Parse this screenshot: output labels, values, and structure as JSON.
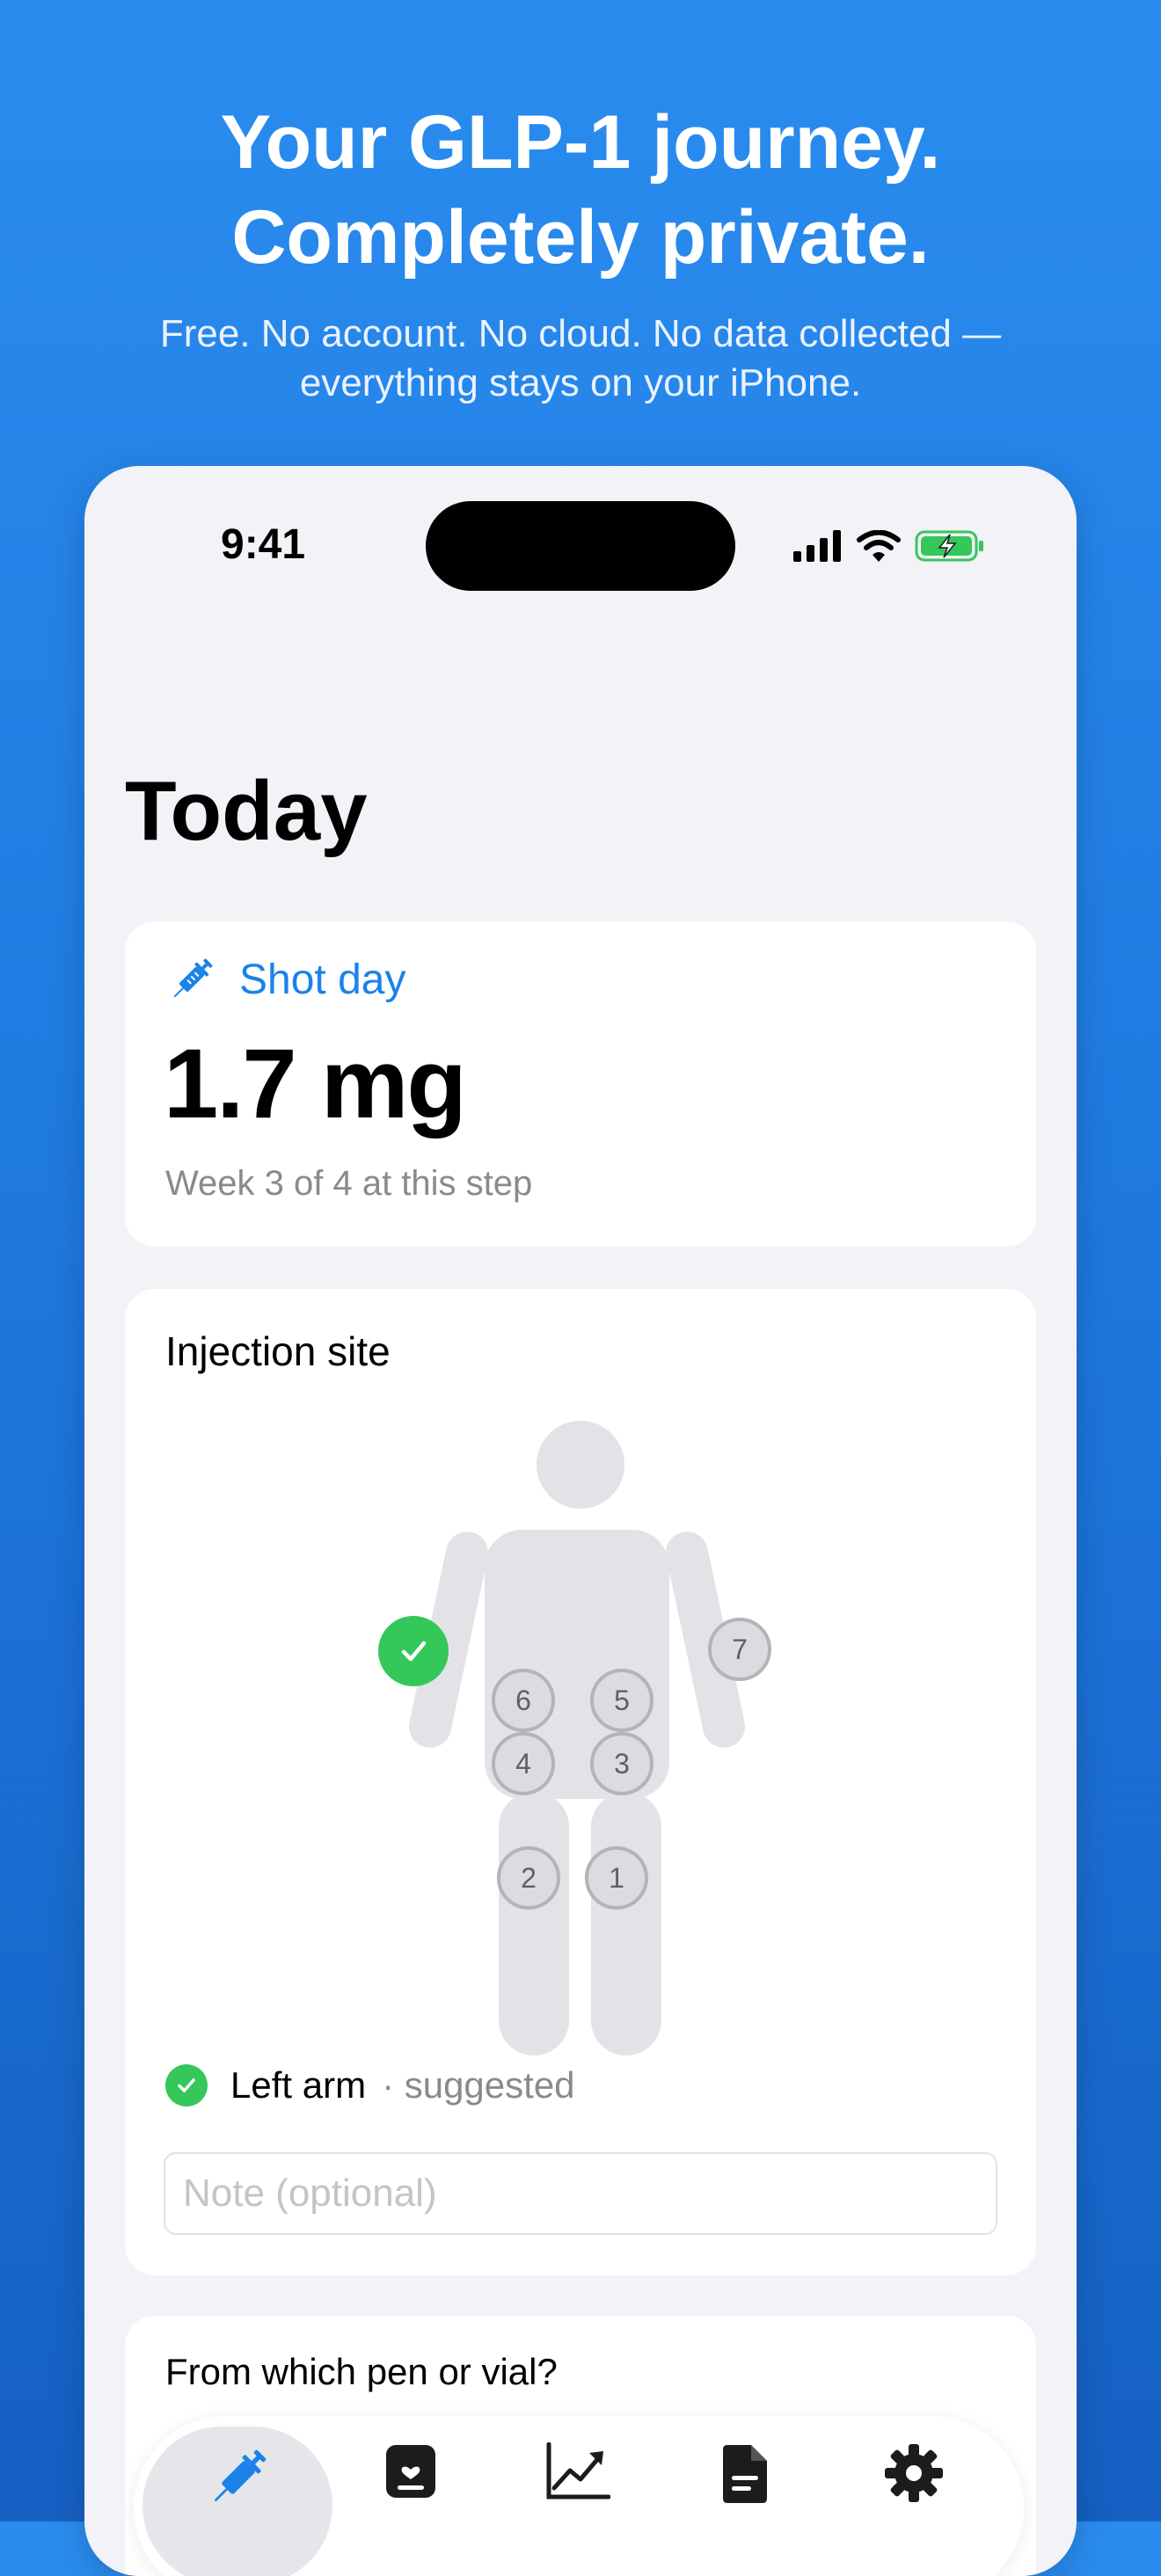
{
  "promo": {
    "headline_line1": "Your GLP-1 journey.",
    "headline_line2": "Completely private.",
    "subtitle_line1": "Free. No account. No cloud. No data collected —",
    "subtitle_line2": "everything stays on your iPhone."
  },
  "status_bar": {
    "time": "9:41",
    "icons": [
      "cellular-signal-icon",
      "wifi-icon",
      "battery-charging-icon"
    ]
  },
  "page": {
    "title": "Today"
  },
  "shot_card": {
    "label": "Shot day",
    "icon": "syringe-icon",
    "dose": "1.7 mg",
    "step_text": "Week 3 of 4 at this step"
  },
  "injection_site": {
    "title": "Injection site",
    "sites": [
      "1",
      "2",
      "3",
      "4",
      "5",
      "6",
      "7"
    ],
    "selected_site": "Left arm",
    "selected_suffix": "· suggested",
    "note_placeholder": "Note (optional)",
    "note_value": ""
  },
  "pen_card": {
    "title": "From which pen or vial?"
  },
  "tab_bar": {
    "items": [
      {
        "icon": "syringe-icon",
        "selected": true
      },
      {
        "icon": "health-card-icon",
        "selected": false
      },
      {
        "icon": "trend-chart-icon",
        "selected": false
      },
      {
        "icon": "document-icon",
        "selected": false
      },
      {
        "icon": "gear-icon",
        "selected": false
      }
    ]
  },
  "colors": {
    "accent": "#1a82ea",
    "success": "#34c759",
    "background_top": "#2a8cef",
    "background_bottom": "#1560c2"
  }
}
